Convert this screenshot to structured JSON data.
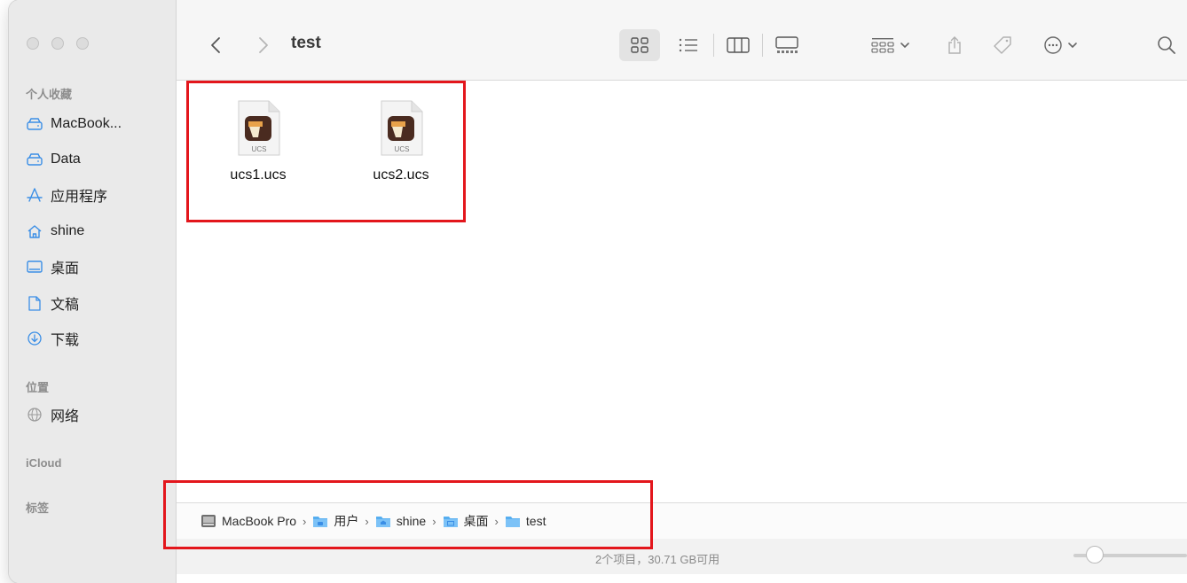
{
  "window": {
    "title": "test"
  },
  "sidebar": {
    "favorites_header": "个人收藏",
    "favorites": [
      {
        "label": "MacBook...",
        "icon": "drive-icon"
      },
      {
        "label": "Data",
        "icon": "drive-icon"
      },
      {
        "label": "应用程序",
        "icon": "applications-icon"
      },
      {
        "label": "shine",
        "icon": "home-icon"
      },
      {
        "label": "桌面",
        "icon": "desktop-icon"
      },
      {
        "label": "文稿",
        "icon": "document-icon"
      },
      {
        "label": "下载",
        "icon": "download-icon"
      }
    ],
    "locations_header": "位置",
    "locations": [
      {
        "label": "网络",
        "icon": "network-icon"
      }
    ],
    "icloud_header": "iCloud",
    "tags_header": "标签"
  },
  "toolbar": {
    "back_icon": "chevron-left-icon",
    "forward_icon": "chevron-right-icon",
    "view_selected": "icon-view"
  },
  "files": [
    {
      "name": "ucs1.ucs",
      "ext_label": "UCS"
    },
    {
      "name": "ucs2.ucs",
      "ext_label": "UCS"
    }
  ],
  "pathbar": [
    {
      "label": "MacBook Pro",
      "icon": "hard-drive-icon"
    },
    {
      "label": "用户",
      "icon": "folder-icon"
    },
    {
      "label": "shine",
      "icon": "home-folder-icon"
    },
    {
      "label": "桌面",
      "icon": "desktop-folder-icon"
    },
    {
      "label": "test",
      "icon": "folder-icon"
    }
  ],
  "pathbar_separator": "›",
  "status": {
    "text": "2个项目，30.71 GB可用"
  },
  "colors": {
    "accent": "#3a8ee6",
    "annotation": "#e3161c",
    "sidebar_bg": "#eaeaea"
  }
}
